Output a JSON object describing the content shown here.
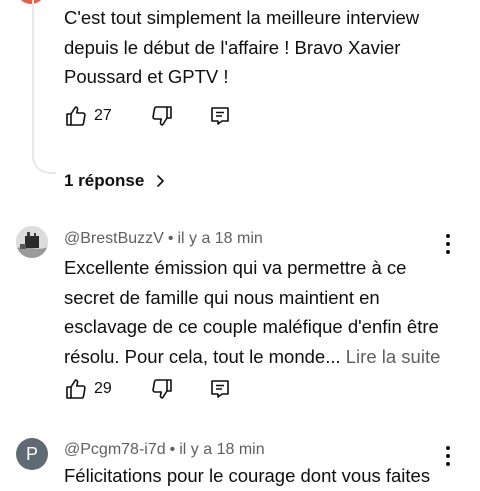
{
  "reply_comment": {
    "text_lines": [
      "C'est tout simplement la meilleure interview",
      "depuis le début de l'affaire ! Bravo Xavier",
      "Poussard et GPTV !"
    ],
    "likes": "27"
  },
  "replies_link": {
    "label": "1 réponse"
  },
  "comments": [
    {
      "author": "@BrestBuzzV",
      "time": "il y a 18 min",
      "text_lines": [
        "Excellente émission qui va permettre à ce",
        "secret de famille qui nous maintient en",
        "esclavage de ce couple maléfique d'enfin être",
        "résolu. Pour cela, tout le monde..."
      ],
      "read_more": "Lire la suite",
      "likes": "29"
    },
    {
      "author": "@Pcgm78-i7d",
      "time": "il y a 18 min",
      "avatar_letter": "P",
      "text_lines": [
        "Félicitations pour le courage dont vous faites"
      ]
    }
  ],
  "meta_separator": "•",
  "colors": {
    "text": "#0f0f0f",
    "secondary": "#606060",
    "avatar_p": "#606a74",
    "top_avatar": "#e2624a"
  },
  "icons": [
    "thumbs-up-icon",
    "thumbs-down-icon",
    "reply-icon",
    "chevron-right-icon",
    "more-vert-icon"
  ]
}
